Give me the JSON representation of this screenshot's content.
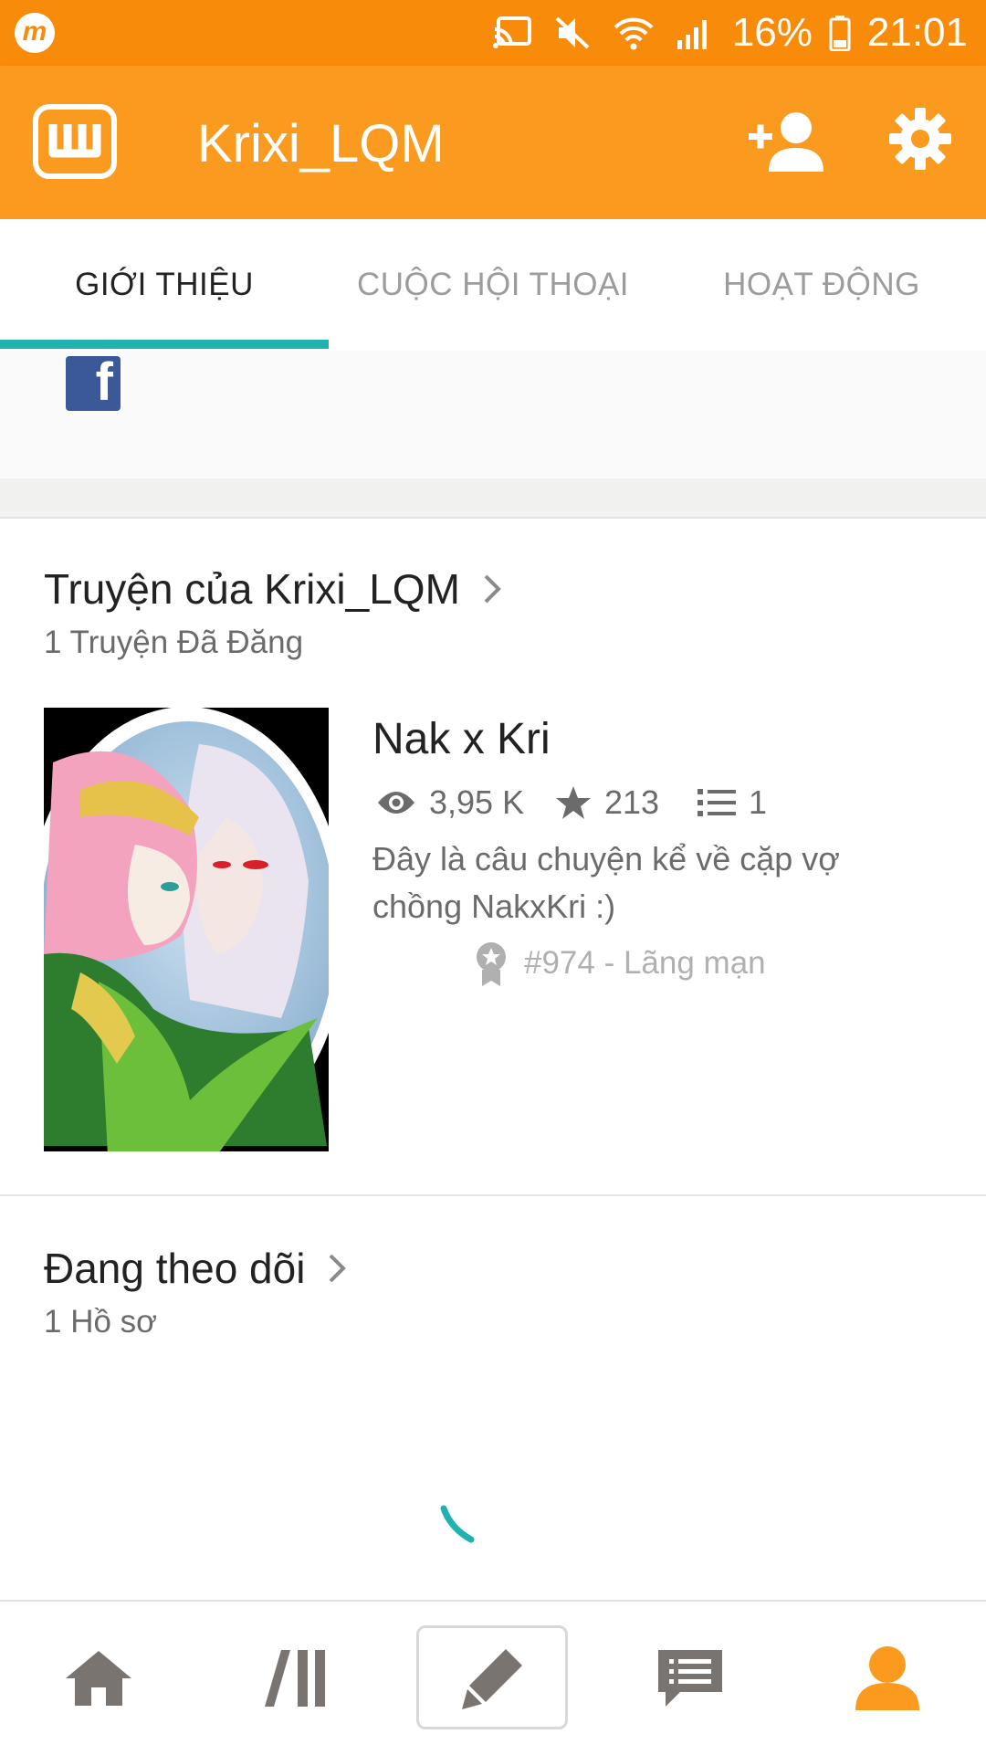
{
  "status_bar": {
    "app_icon": "m-icon",
    "battery": "16%",
    "time": "21:01",
    "icons": [
      "cast-icon",
      "mute-icon",
      "wifi-icon",
      "signal-icon",
      "battery-icon"
    ]
  },
  "app_bar": {
    "logo": "wattpad-logo",
    "title": "Krixi_LQM",
    "actions": [
      "add-user-icon",
      "gear-icon"
    ]
  },
  "tabs": [
    {
      "label": "GIỚI THIỆU",
      "active": true
    },
    {
      "label": "CUỘC HỘI THOẠI",
      "active": false
    },
    {
      "label": "HOẠT ĐỘNG",
      "active": false
    }
  ],
  "social": {
    "icon": "facebook-icon"
  },
  "stories_section": {
    "title": "Truyện của Krixi_LQM",
    "subtitle": "1 Truyện Đã Đăng",
    "story": {
      "title": "Nak x Kri",
      "reads": "3,95 K",
      "votes": "213",
      "parts": "1",
      "description": "Đây là câu chuyện kể về cặp vợ chồng NakxKri :)",
      "rank": "#974 - Lãng mạn"
    }
  },
  "following_section": {
    "title": "Đang theo dõi",
    "subtitle": "1 Hồ sơ"
  },
  "bottom_nav": [
    "home-icon",
    "library-icon",
    "pencil-icon",
    "messages-icon",
    "profile-icon"
  ],
  "colors": {
    "status_bar": "#f98b0a",
    "app_bar": "#fa9a1e",
    "tab_indicator": "#1fb2ae",
    "active_nav": "#fa9a1e",
    "inactive_nav": "#7a7470"
  }
}
